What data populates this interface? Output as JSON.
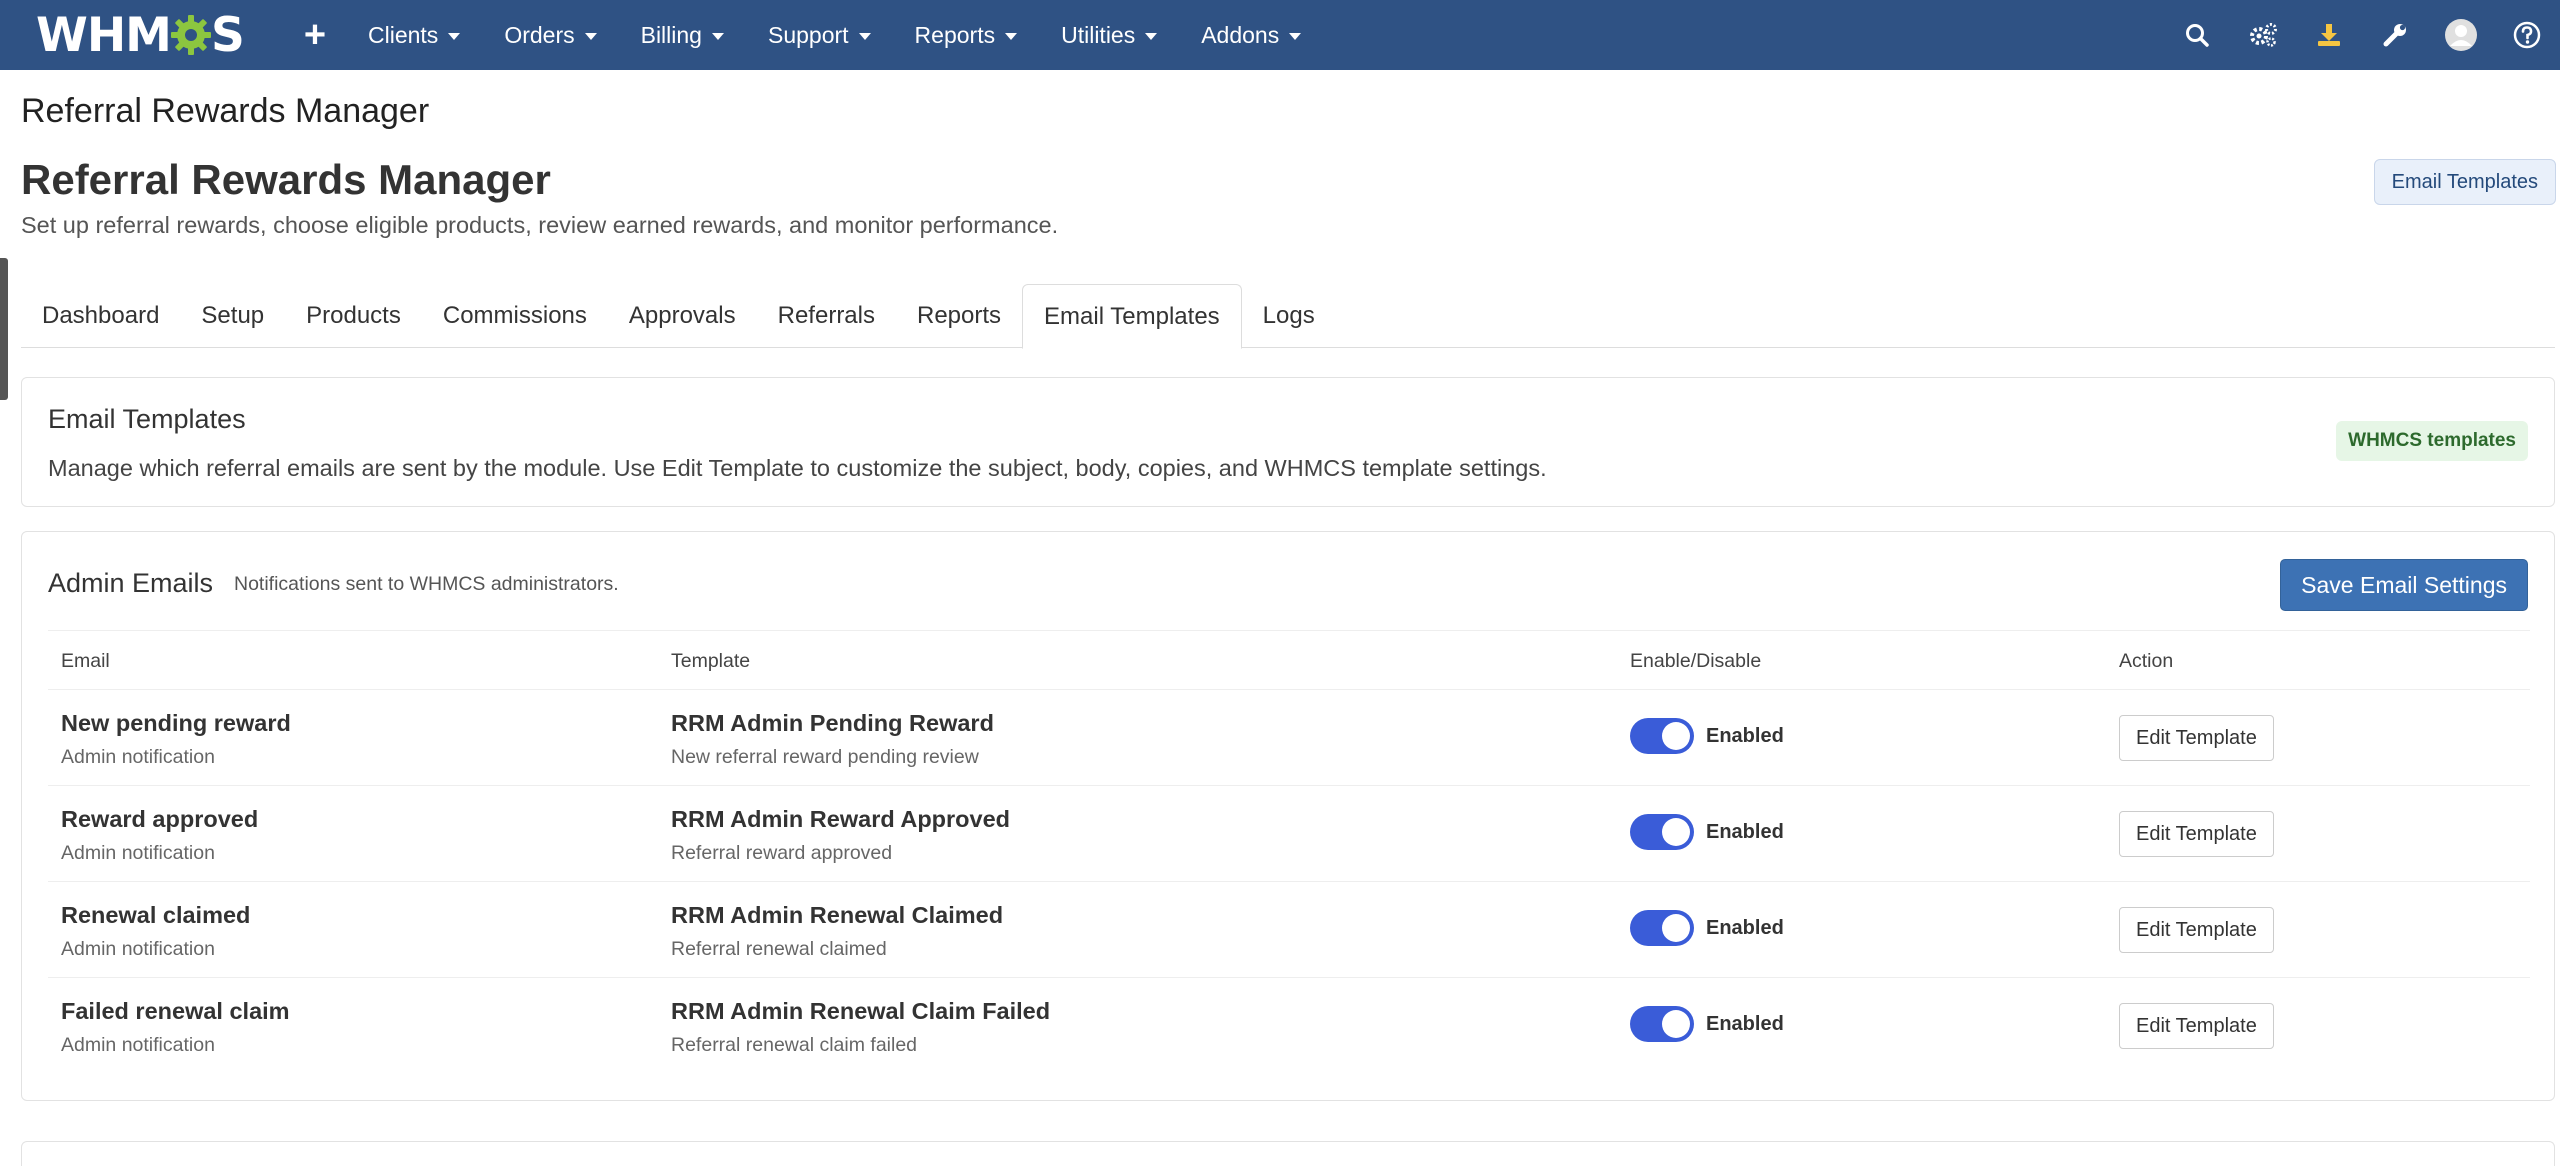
{
  "colors": {
    "topbar": "#2f5284",
    "primary_button": "#3d72b4",
    "toggle_on": "#3a5cd8",
    "badge_green_bg": "#e6f6e6",
    "logo_gear": "#8cc63f"
  },
  "topbar": {
    "logo_left": "WHM",
    "logo_right": "S",
    "plus_label": "+",
    "menu": [
      {
        "label": "Clients"
      },
      {
        "label": "Orders"
      },
      {
        "label": "Billing"
      },
      {
        "label": "Support"
      },
      {
        "label": "Reports"
      },
      {
        "label": "Utilities"
      },
      {
        "label": "Addons"
      }
    ],
    "tools": [
      "search-icon",
      "cogs-icon",
      "download-icon",
      "wrench-icon",
      "avatar",
      "help-icon"
    ]
  },
  "page": {
    "breadcrumb_title": "Referral Rewards Manager",
    "title": "Referral Rewards Manager",
    "subtitle": "Set up referral rewards, choose eligible products, review earned rewards, and monitor performance.",
    "header_button": "Email Templates"
  },
  "tabs": [
    {
      "label": "Dashboard"
    },
    {
      "label": "Setup"
    },
    {
      "label": "Products"
    },
    {
      "label": "Commissions"
    },
    {
      "label": "Approvals"
    },
    {
      "label": "Referrals"
    },
    {
      "label": "Reports"
    },
    {
      "label": "Email Templates",
      "active": true
    },
    {
      "label": "Logs"
    }
  ],
  "intro_card": {
    "title": "Email Templates",
    "description": "Manage which referral emails are sent by the module. Use Edit Template to customize the subject, body, copies, and WHMCS template settings.",
    "badge": "WHMCS templates"
  },
  "admin_emails": {
    "title": "Admin Emails",
    "note": "Notifications sent to WHMCS administrators.",
    "save_button": "Save Email Settings",
    "columns": {
      "email": "Email",
      "template": "Template",
      "toggle": "Enable/Disable",
      "action": "Action"
    },
    "rows": [
      {
        "email": "New pending reward",
        "email_sub": "Admin notification",
        "template": "RRM Admin Pending Reward",
        "template_sub": "New referral reward pending review",
        "status": "Enabled",
        "action": "Edit Template"
      },
      {
        "email": "Reward approved",
        "email_sub": "Admin notification",
        "template": "RRM Admin Reward Approved",
        "template_sub": "Referral reward approved",
        "status": "Enabled",
        "action": "Edit Template"
      },
      {
        "email": "Renewal claimed",
        "email_sub": "Admin notification",
        "template": "RRM Admin Renewal Claimed",
        "template_sub": "Referral renewal claimed",
        "status": "Enabled",
        "action": "Edit Template"
      },
      {
        "email": "Failed renewal claim",
        "email_sub": "Admin notification",
        "template": "RRM Admin Renewal Claim Failed",
        "template_sub": "Referral renewal claim failed",
        "status": "Enabled",
        "action": "Edit Template"
      }
    ]
  }
}
